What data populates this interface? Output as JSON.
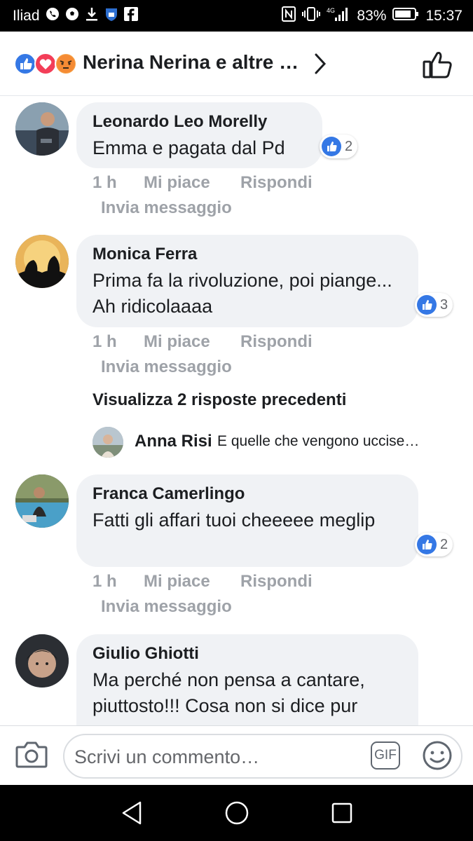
{
  "status_bar": {
    "carrier": "Iliad",
    "network": "4G",
    "battery": "83%",
    "time": "15:37"
  },
  "header": {
    "title": "Nerina Nerina e altre …",
    "reactions": [
      "like",
      "love",
      "angry"
    ]
  },
  "comments": [
    {
      "author": "Leonardo Leo Morelly",
      "text": "Emma e pagata dal Pd",
      "likes": "2",
      "time": "1 h",
      "like_label": "Mi piace",
      "reply_label": "Rispondi",
      "message_label": "Invia messaggio"
    },
    {
      "author": "Monica Ferra",
      "text": "Prima fa la rivoluzione, poi piange... Ah ridicolaaaa",
      "likes": "3",
      "time": "1 h",
      "like_label": "Mi piace",
      "reply_label": "Rispondi",
      "message_label": "Invia messaggio"
    },
    {
      "author": "Franca Camerlingo",
      "text": "Fatti gli affari tuoi cheeeee meglip",
      "likes": "2",
      "time": "1 h",
      "like_label": "Mi piace",
      "reply_label": "Rispondi",
      "message_label": "Invia messaggio"
    },
    {
      "author": "Giulio Ghiotti",
      "text": "Ma perché non pensa a cantare, piuttosto!!! Cosa non si dice pur"
    }
  ],
  "view_previous_replies": "Visualizza 2 risposte precedenti",
  "reply_preview": {
    "author": "Anna Risi",
    "text": "E quelle che vengono uccise…"
  },
  "composer": {
    "placeholder": "Scrivi un commento…",
    "gif_label": "GIF"
  }
}
